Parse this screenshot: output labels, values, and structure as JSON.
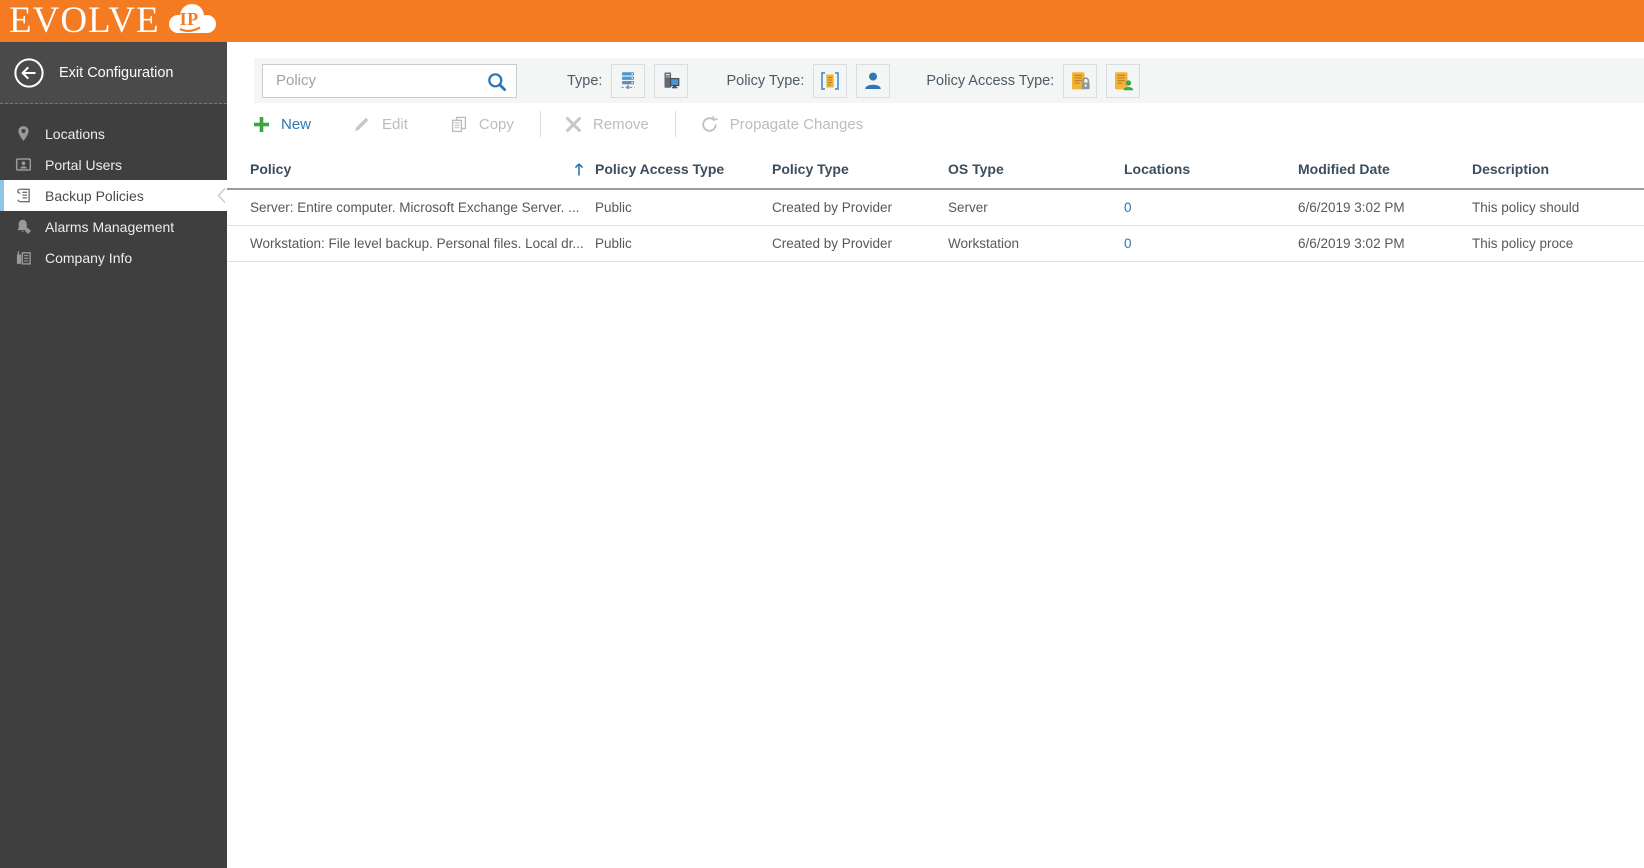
{
  "header": {
    "logo_text": "EVOLVE",
    "logo_badge": "IP"
  },
  "sidebar": {
    "exit_label": "Exit Configuration",
    "items": [
      {
        "label": "Locations",
        "icon": "location-pin-icon",
        "selected": false
      },
      {
        "label": "Portal Users",
        "icon": "portal-user-card-icon",
        "selected": false
      },
      {
        "label": "Backup Policies",
        "icon": "policy-scroll-icon",
        "selected": true
      },
      {
        "label": "Alarms Management",
        "icon": "alarm-bell-gear-icon",
        "selected": false
      },
      {
        "label": "Company Info",
        "icon": "company-building-icon",
        "selected": false
      }
    ]
  },
  "filters": {
    "search": {
      "placeholder": "Policy",
      "icon": "search-icon"
    },
    "type_label": "Type:",
    "type_buttons": [
      {
        "icon": "server-icon"
      },
      {
        "icon": "workstation-icon"
      }
    ],
    "policy_type_label": "Policy Type:",
    "policy_type_buttons": [
      {
        "icon": "provider-policy-scroll-icon"
      },
      {
        "icon": "user-person-icon"
      }
    ],
    "policy_access_type_label": "Policy Access Type:",
    "policy_access_type_buttons": [
      {
        "icon": "private-policy-lock-icon"
      },
      {
        "icon": "public-policy-person-icon"
      }
    ]
  },
  "toolbar": {
    "new_label": "New",
    "edit_label": "Edit",
    "copy_label": "Copy",
    "remove_label": "Remove",
    "propagate_label": "Propagate Changes"
  },
  "table": {
    "columns": [
      "Policy",
      "Policy Access Type",
      "Policy Type",
      "OS Type",
      "Locations",
      "Modified Date",
      "Description"
    ],
    "sort": {
      "column": "Policy",
      "direction": "ascending"
    },
    "rows": [
      {
        "policy": "Server: Entire computer. Microsoft Exchange Server. ...",
        "policy_access_type": "Public",
        "policy_type": "Created by Provider",
        "os_type": "Server",
        "locations": "0",
        "modified_date": "6/6/2019 3:02 PM",
        "description": "This policy should"
      },
      {
        "policy": "Workstation: File level backup. Personal files. Local dr...",
        "policy_access_type": "Public",
        "policy_type": "Created by Provider",
        "os_type": "Workstation",
        "locations": "0",
        "modified_date": "6/6/2019 3:02 PM",
        "description": "This policy proce"
      }
    ]
  },
  "colors": {
    "brand_orange": "#F47B21",
    "link_blue": "#2876B8",
    "accent_green": "#3FA33F",
    "sidebar_bg": "#3F3F3F",
    "selected_accent": "#8CC7E8",
    "filterbar_bg": "#F4F5F5"
  }
}
